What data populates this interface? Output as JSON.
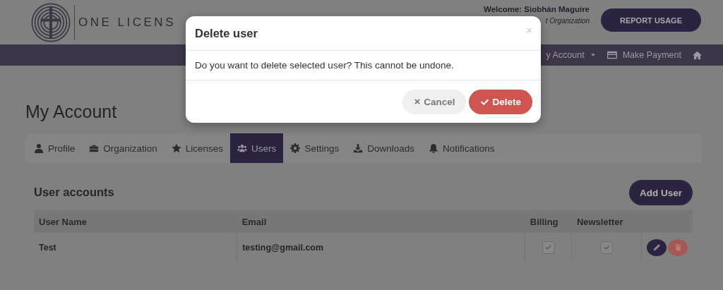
{
  "header": {
    "logo_text": "ONE LICENS",
    "welcome": "Welcome: Siobhán Maguire",
    "organization": "t Organization",
    "report_button": "REPORT USAGE"
  },
  "nav": [
    {
      "kind": "dropdown",
      "label": "y Account"
    },
    {
      "kind": "payment",
      "label": "Make Payment"
    },
    {
      "kind": "home"
    }
  ],
  "page_title": "My Account",
  "tabs": [
    {
      "kind": "user",
      "label": "Profile",
      "selected": false
    },
    {
      "kind": "briefcase",
      "label": "Organization",
      "selected": false
    },
    {
      "kind": "star",
      "label": "Licenses",
      "selected": false
    },
    {
      "kind": "users",
      "label": "Users",
      "selected": true
    },
    {
      "kind": "gear",
      "label": "Settings",
      "selected": false
    },
    {
      "kind": "download",
      "label": "Downloads",
      "selected": false
    },
    {
      "kind": "bell",
      "label": "Notifications",
      "selected": false
    }
  ],
  "users": {
    "heading": "User accounts",
    "add_button": "Add User",
    "columns": [
      "User Name",
      "Email",
      "Billing",
      "Newsletter"
    ],
    "rows": [
      {
        "user_name": "Test",
        "email": "testing@gmail.com",
        "billing": true,
        "newsletter": true
      }
    ]
  },
  "dialog": {
    "title": "Delete user",
    "close": "×",
    "message": "Do you want to delete selected user? This cannot be undone.",
    "buttons": [
      {
        "kind": "cancel",
        "label": "Cancel"
      },
      {
        "kind": "confirm",
        "label": "Delete"
      }
    ]
  }
}
